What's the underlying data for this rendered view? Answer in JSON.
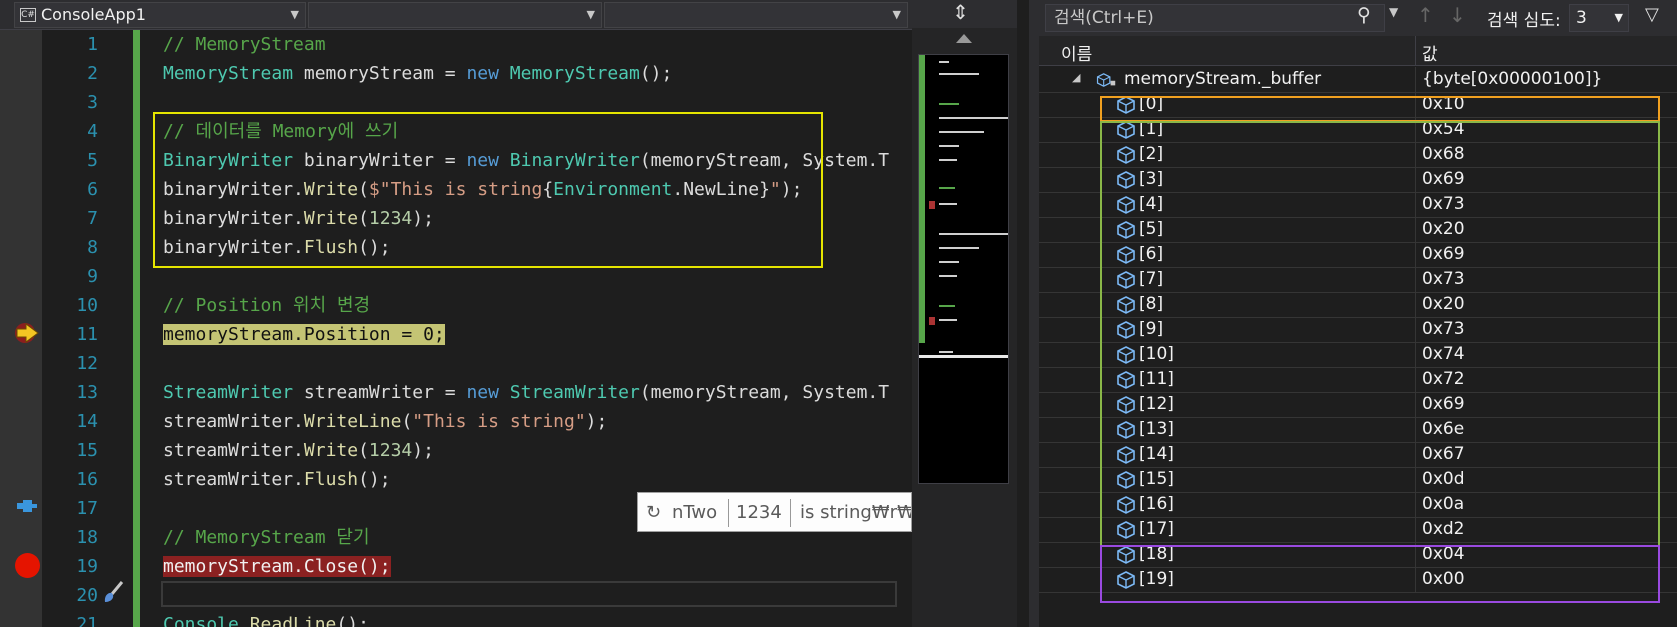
{
  "navbar": {
    "project": "ConsoleApp1",
    "project_icon": "C#",
    "type_member": "",
    "member": ""
  },
  "editor": {
    "lines": [
      {
        "n": "1",
        "parts": [
          {
            "c": "c",
            "t": "// MemoryStream"
          }
        ]
      },
      {
        "n": "2",
        "parts": [
          {
            "c": "t",
            "t": "MemoryStream"
          },
          {
            "c": "",
            "t": " memoryStream = "
          },
          {
            "c": "k",
            "t": "new"
          },
          {
            "c": "",
            "t": " "
          },
          {
            "c": "t",
            "t": "MemoryStream"
          },
          {
            "c": "",
            "t": "();"
          }
        ]
      },
      {
        "n": "3",
        "parts": []
      },
      {
        "n": "4",
        "parts": [
          {
            "c": "c",
            "t": "// 데이터를 Memory에 쓰기"
          }
        ]
      },
      {
        "n": "5",
        "parts": [
          {
            "c": "t",
            "t": "BinaryWriter"
          },
          {
            "c": "",
            "t": " binaryWriter = "
          },
          {
            "c": "k",
            "t": "new"
          },
          {
            "c": "",
            "t": " "
          },
          {
            "c": "t",
            "t": "BinaryWriter"
          },
          {
            "c": "",
            "t": "(memoryStream, System.T"
          }
        ]
      },
      {
        "n": "6",
        "parts": [
          {
            "c": "",
            "t": "binaryWriter."
          },
          {
            "c": "m",
            "t": "Write"
          },
          {
            "c": "",
            "t": "("
          },
          {
            "c": "s",
            "t": "$\"This is string"
          },
          {
            "c": "",
            "t": "{"
          },
          {
            "c": "t",
            "t": "Environment"
          },
          {
            "c": "",
            "t": ".NewLine}"
          },
          {
            "c": "s",
            "t": "\""
          },
          {
            "c": "",
            "t": ");"
          }
        ]
      },
      {
        "n": "7",
        "parts": [
          {
            "c": "",
            "t": "binaryWriter."
          },
          {
            "c": "m",
            "t": "Write"
          },
          {
            "c": "",
            "t": "("
          },
          {
            "c": "n",
            "t": "1234"
          },
          {
            "c": "",
            "t": ");"
          }
        ]
      },
      {
        "n": "8",
        "parts": [
          {
            "c": "",
            "t": "binaryWriter."
          },
          {
            "c": "m",
            "t": "Flush"
          },
          {
            "c": "",
            "t": "();"
          }
        ]
      },
      {
        "n": "9",
        "parts": []
      },
      {
        "n": "10",
        "parts": [
          {
            "c": "c",
            "t": "// Position 위치 변경"
          }
        ]
      },
      {
        "n": "11",
        "parts": [
          {
            "c": "curhl",
            "t": "memoryStream.Position = 0;"
          }
        ]
      },
      {
        "n": "12",
        "parts": []
      },
      {
        "n": "13",
        "parts": [
          {
            "c": "t",
            "t": "StreamWriter"
          },
          {
            "c": "",
            "t": " streamWriter = "
          },
          {
            "c": "k",
            "t": "new"
          },
          {
            "c": "",
            "t": " "
          },
          {
            "c": "t",
            "t": "StreamWriter"
          },
          {
            "c": "",
            "t": "(memoryStream, System.T"
          }
        ]
      },
      {
        "n": "14",
        "parts": [
          {
            "c": "",
            "t": "streamWriter."
          },
          {
            "c": "m",
            "t": "WriteLine"
          },
          {
            "c": "",
            "t": "("
          },
          {
            "c": "s",
            "t": "\"This is string\""
          },
          {
            "c": "",
            "t": ");"
          }
        ]
      },
      {
        "n": "15",
        "parts": [
          {
            "c": "",
            "t": "streamWriter."
          },
          {
            "c": "m",
            "t": "Write"
          },
          {
            "c": "",
            "t": "("
          },
          {
            "c": "n",
            "t": "1234"
          },
          {
            "c": "",
            "t": ");"
          }
        ]
      },
      {
        "n": "16",
        "parts": [
          {
            "c": "",
            "t": "streamWriter."
          },
          {
            "c": "m",
            "t": "Flush"
          },
          {
            "c": "",
            "t": "();"
          }
        ]
      },
      {
        "n": "17",
        "parts": []
      },
      {
        "n": "18",
        "parts": [
          {
            "c": "c",
            "t": "// MemoryStream 닫기"
          }
        ]
      },
      {
        "n": "19",
        "parts": [
          {
            "c": "bphl",
            "t": "memoryStream.Close();"
          }
        ]
      },
      {
        "n": "20",
        "parts": []
      },
      {
        "n": "21",
        "parts": [
          {
            "c": "t",
            "t": "Console"
          },
          {
            "c": "",
            "t": "."
          },
          {
            "c": "m",
            "t": "ReadLine"
          },
          {
            "c": "",
            "t": "();"
          }
        ]
      }
    ]
  },
  "datatip": {
    "item1": "nTwo",
    "item2": "1234",
    "item3": "is string₩r₩"
  },
  "watch": {
    "search_placeholder": "검색(Ctrl+E)",
    "depth_label": "검색 심도:",
    "depth_value": "3",
    "col_name": "이름",
    "col_value": "값",
    "root": {
      "name": "memoryStream._buffer",
      "value": "{byte[0x00000100]}"
    },
    "items": [
      {
        "name": "[0]",
        "value": "0x10"
      },
      {
        "name": "[1]",
        "value": "0x54"
      },
      {
        "name": "[2]",
        "value": "0x68"
      },
      {
        "name": "[3]",
        "value": "0x69"
      },
      {
        "name": "[4]",
        "value": "0x73"
      },
      {
        "name": "[5]",
        "value": "0x20"
      },
      {
        "name": "[6]",
        "value": "0x69"
      },
      {
        "name": "[7]",
        "value": "0x73"
      },
      {
        "name": "[8]",
        "value": "0x20"
      },
      {
        "name": "[9]",
        "value": "0x73"
      },
      {
        "name": "[10]",
        "value": "0x74"
      },
      {
        "name": "[11]",
        "value": "0x72"
      },
      {
        "name": "[12]",
        "value": "0x69"
      },
      {
        "name": "[13]",
        "value": "0x6e"
      },
      {
        "name": "[14]",
        "value": "0x67"
      },
      {
        "name": "[15]",
        "value": "0x0d"
      },
      {
        "name": "[16]",
        "value": "0x0a"
      },
      {
        "name": "[17]",
        "value": "0xd2"
      },
      {
        "name": "[18]",
        "value": "0x04"
      },
      {
        "name": "[19]",
        "value": "0x00"
      }
    ]
  },
  "colors": {
    "selection_box": "#e5e500",
    "breakpoint": "#e51400",
    "current_line": "#c4c474",
    "box_orange": "#f0a020",
    "box_green": "#8ab848",
    "box_purple": "#9a4ae0"
  }
}
